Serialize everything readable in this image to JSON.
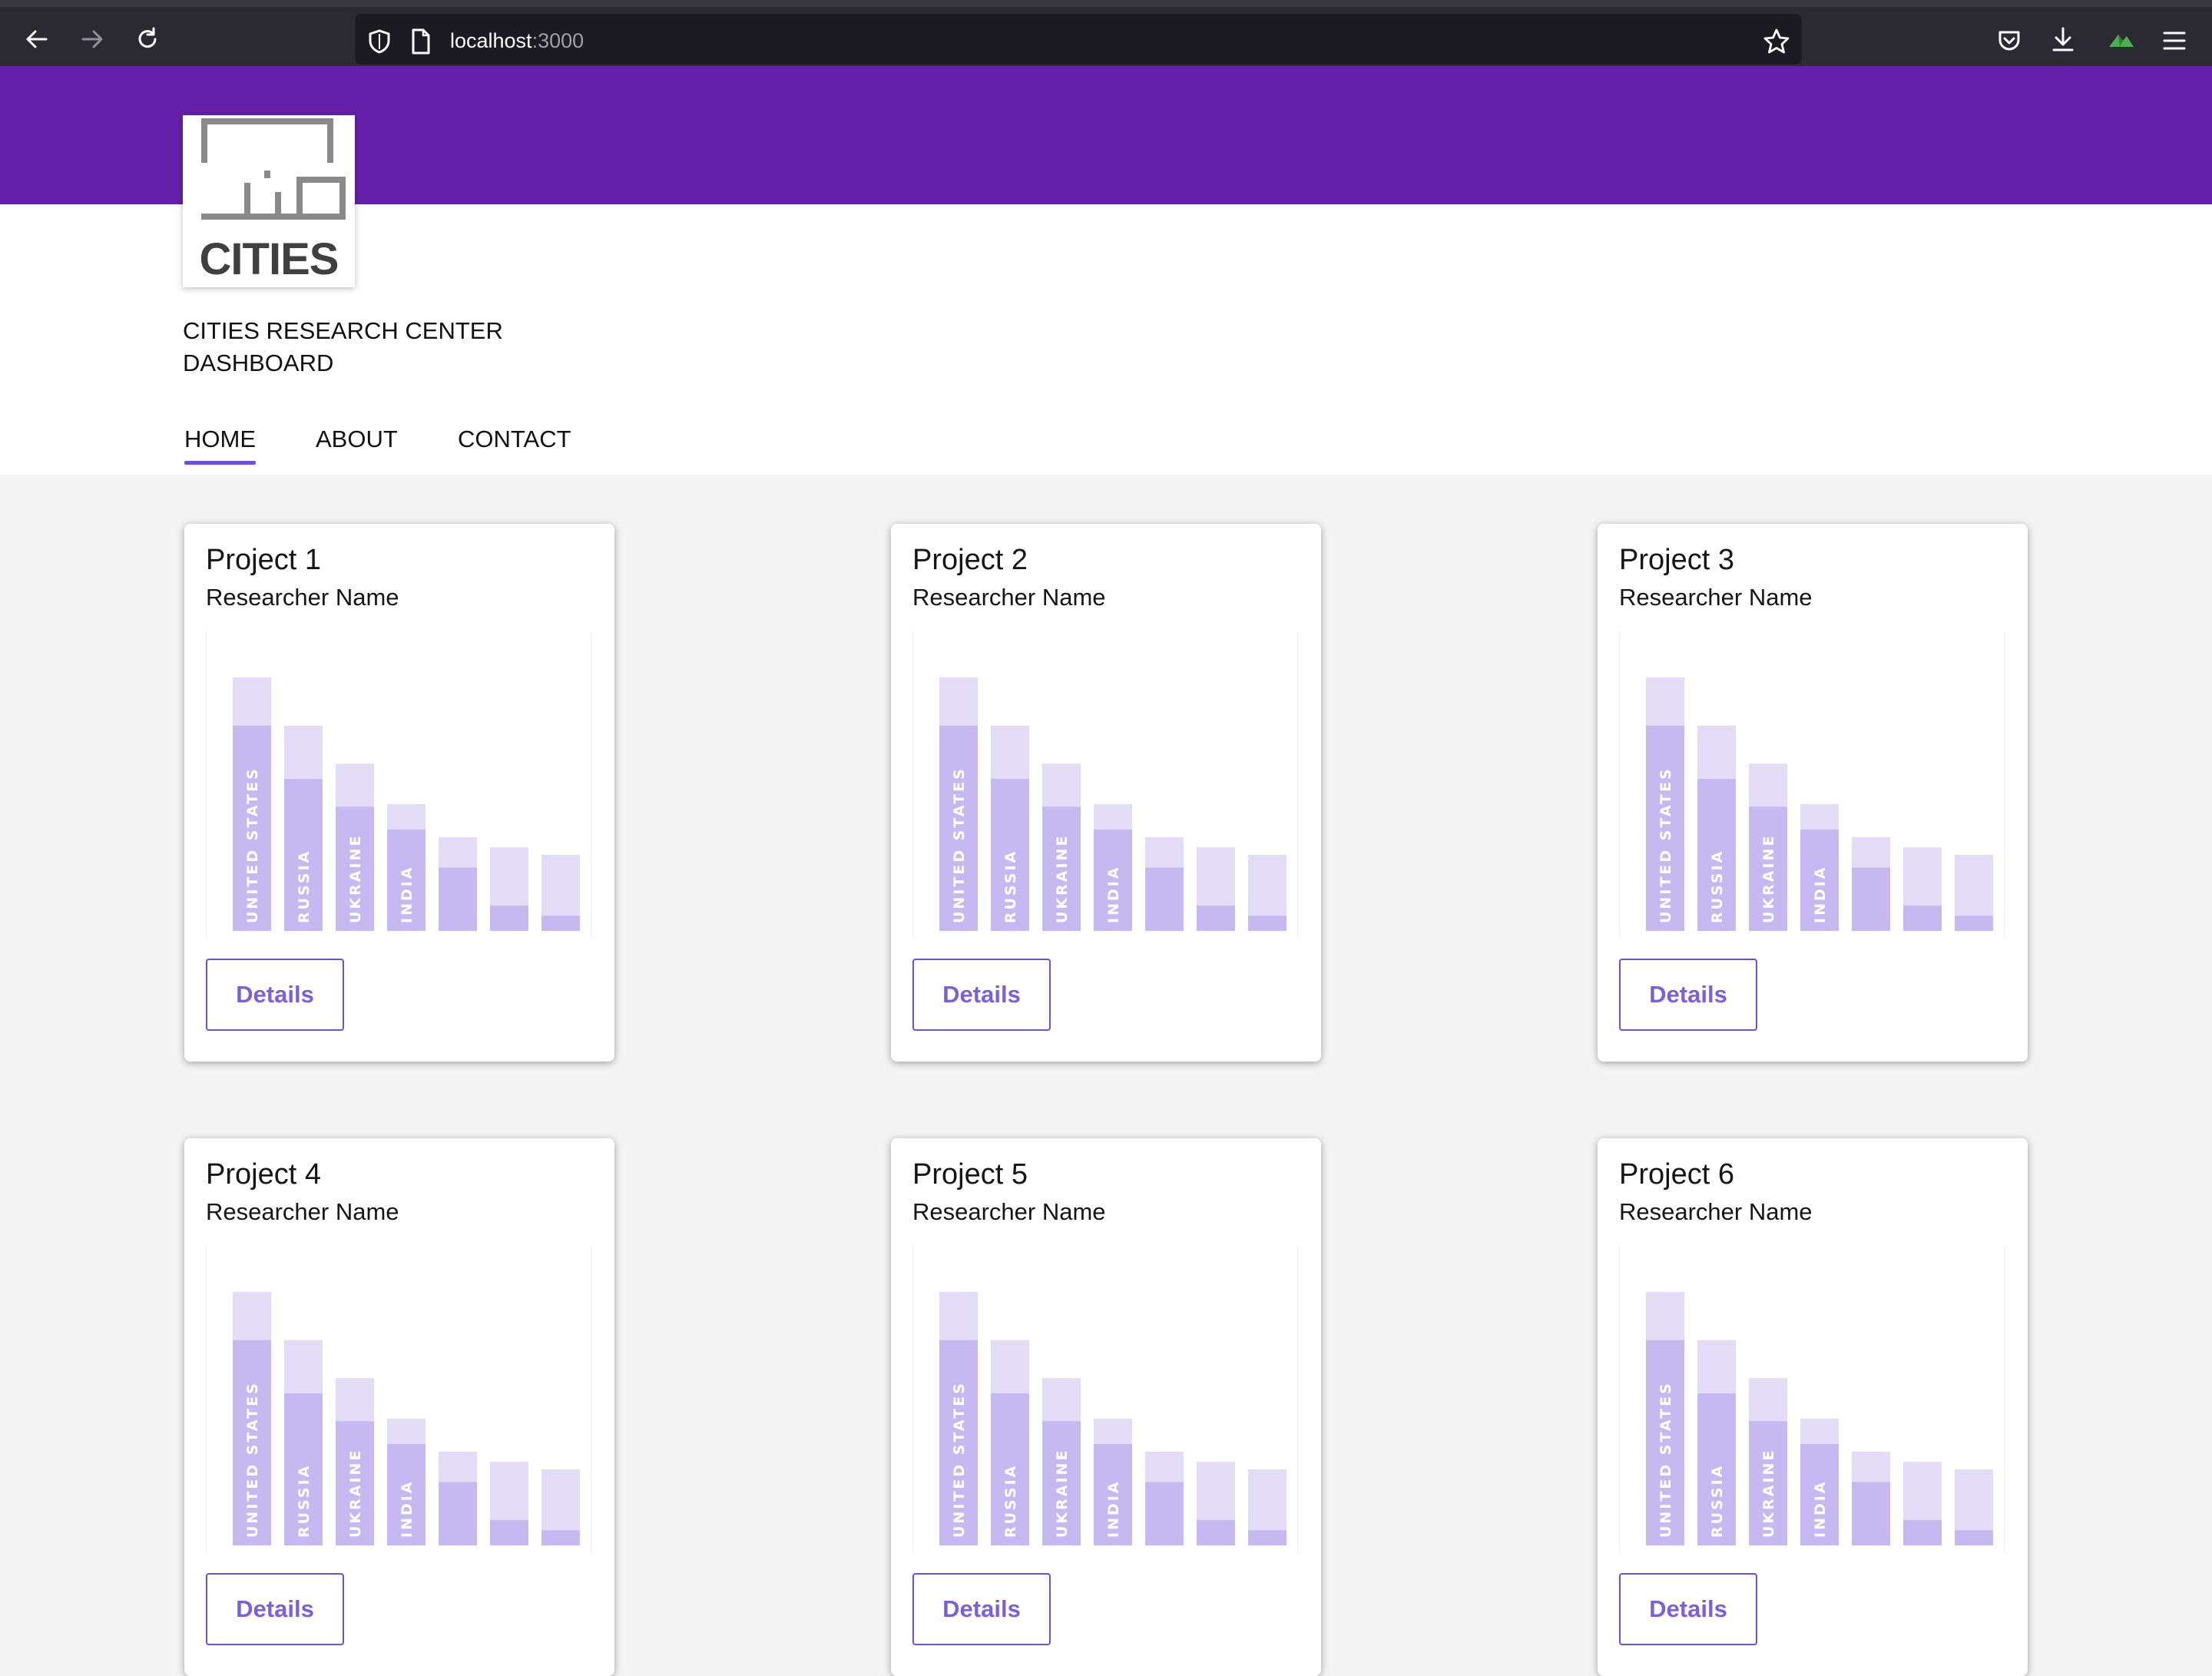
{
  "browser": {
    "url_host": "localhost",
    "url_port": ":3000"
  },
  "site": {
    "logo_text": "CITIES",
    "title_line1": "CITIES RESEARCH CENTER",
    "title_line2": "DASHBOARD",
    "nav": [
      {
        "label": "HOME",
        "active": true
      },
      {
        "label": "ABOUT",
        "active": false
      },
      {
        "label": "CONTACT",
        "active": false
      }
    ]
  },
  "colors": {
    "header": "#6420aa",
    "bar_light": "#e3dcf7",
    "bar_dark": "#c6b8f0",
    "accent": "#6d4fd8"
  },
  "chart_data": {
    "type": "bar",
    "categories": [
      "UNITED STATES",
      "RUSSIA",
      "UKRAINE",
      "INDIA",
      "",
      "",
      ""
    ],
    "series": [
      {
        "values": [
          100,
          81,
          66,
          50,
          37,
          33,
          30
        ]
      },
      {
        "values": [
          81,
          60,
          49,
          40,
          25,
          10,
          6
        ]
      }
    ]
  },
  "cards": [
    {
      "title": "Project 1",
      "researcher": "Researcher Name",
      "button": "Details"
    },
    {
      "title": "Project 2",
      "researcher": "Researcher Name",
      "button": "Details"
    },
    {
      "title": "Project 3",
      "researcher": "Researcher Name",
      "button": "Details"
    },
    {
      "title": "Project 4",
      "researcher": "Researcher Name",
      "button": "Details"
    },
    {
      "title": "Project 5",
      "researcher": "Researcher Name",
      "button": "Details"
    },
    {
      "title": "Project 6",
      "researcher": "Researcher Name",
      "button": "Details"
    }
  ]
}
